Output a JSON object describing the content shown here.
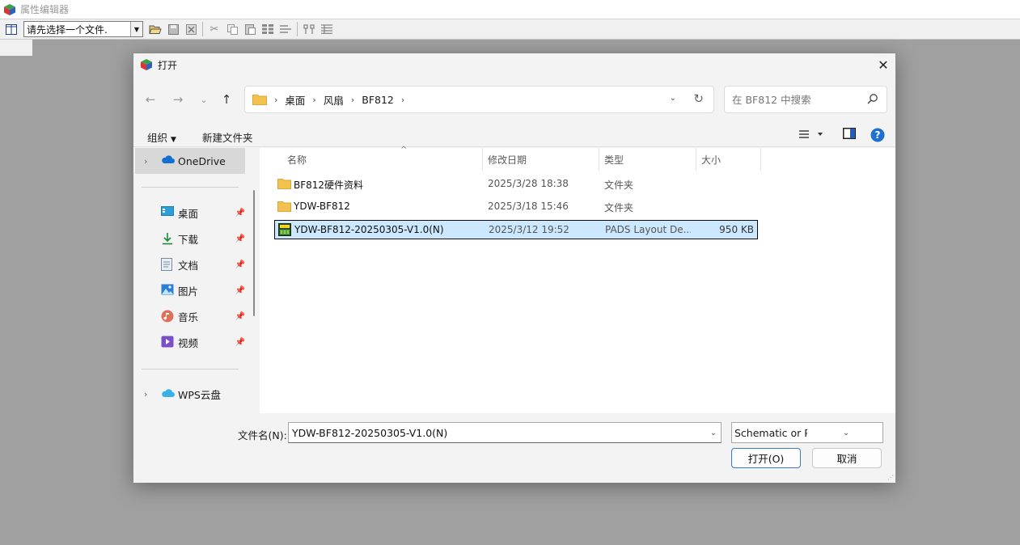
{
  "app": {
    "title": "属性编辑器",
    "file_combo_value": "请先选择一个文件.",
    "toolbar_icons": [
      "layout-icon",
      "open-folder-icon",
      "save-icon",
      "close-file-icon",
      "cut-icon",
      "copy-icon",
      "paste-icon",
      "grid-icon",
      "tab-order-icon",
      "filter-icon",
      "table-icon"
    ]
  },
  "dialog": {
    "title": "打开",
    "breadcrumb": [
      "桌面",
      "风扇",
      "BF812"
    ],
    "search_placeholder": "在 BF812 中搜索",
    "commands": {
      "organize": "组织",
      "new_folder": "新建文件夹"
    },
    "sidebar": {
      "top": [
        {
          "label": "OneDrive",
          "icon": "onedrive-cloud-icon"
        }
      ],
      "quick_access": [
        {
          "label": "桌面",
          "icon": "desktop-icon"
        },
        {
          "label": "下载",
          "icon": "download-icon"
        },
        {
          "label": "文档",
          "icon": "document-icon"
        },
        {
          "label": "图片",
          "icon": "pictures-icon"
        },
        {
          "label": "音乐",
          "icon": "music-icon"
        },
        {
          "label": "视频",
          "icon": "video-icon"
        }
      ],
      "bottom": [
        {
          "label": "WPS云盘",
          "icon": "wps-cloud-icon"
        }
      ]
    },
    "columns": {
      "name": "名称",
      "date": "修改日期",
      "type": "类型",
      "size": "大小"
    },
    "files": [
      {
        "name": "BF812硬件资料",
        "date": "2025/3/28 18:38",
        "type": "文件夹",
        "size": "",
        "icon": "folder-icon",
        "selected": false
      },
      {
        "name": "YDW-BF812",
        "date": "2025/3/18 15:46",
        "type": "文件夹",
        "size": "",
        "icon": "folder-icon",
        "selected": false
      },
      {
        "name": "YDW-BF812-20250305-V1.0(N)",
        "date": "2025/3/12 19:52",
        "type": "PADS Layout De...",
        "size": "950 KB",
        "icon": "pads-file-icon",
        "selected": true
      }
    ],
    "filename_label": "文件名(N):",
    "filename_value": "YDW-BF812-20250305-V1.0(N)",
    "filetype_value": "Schematic or PCB Files(*.sch;",
    "open_label": "打开(O)",
    "cancel_label": "取消",
    "colors": {
      "selection": "#cce8ff",
      "accent": "#3a78c5",
      "folder": "#f2c14e"
    }
  }
}
